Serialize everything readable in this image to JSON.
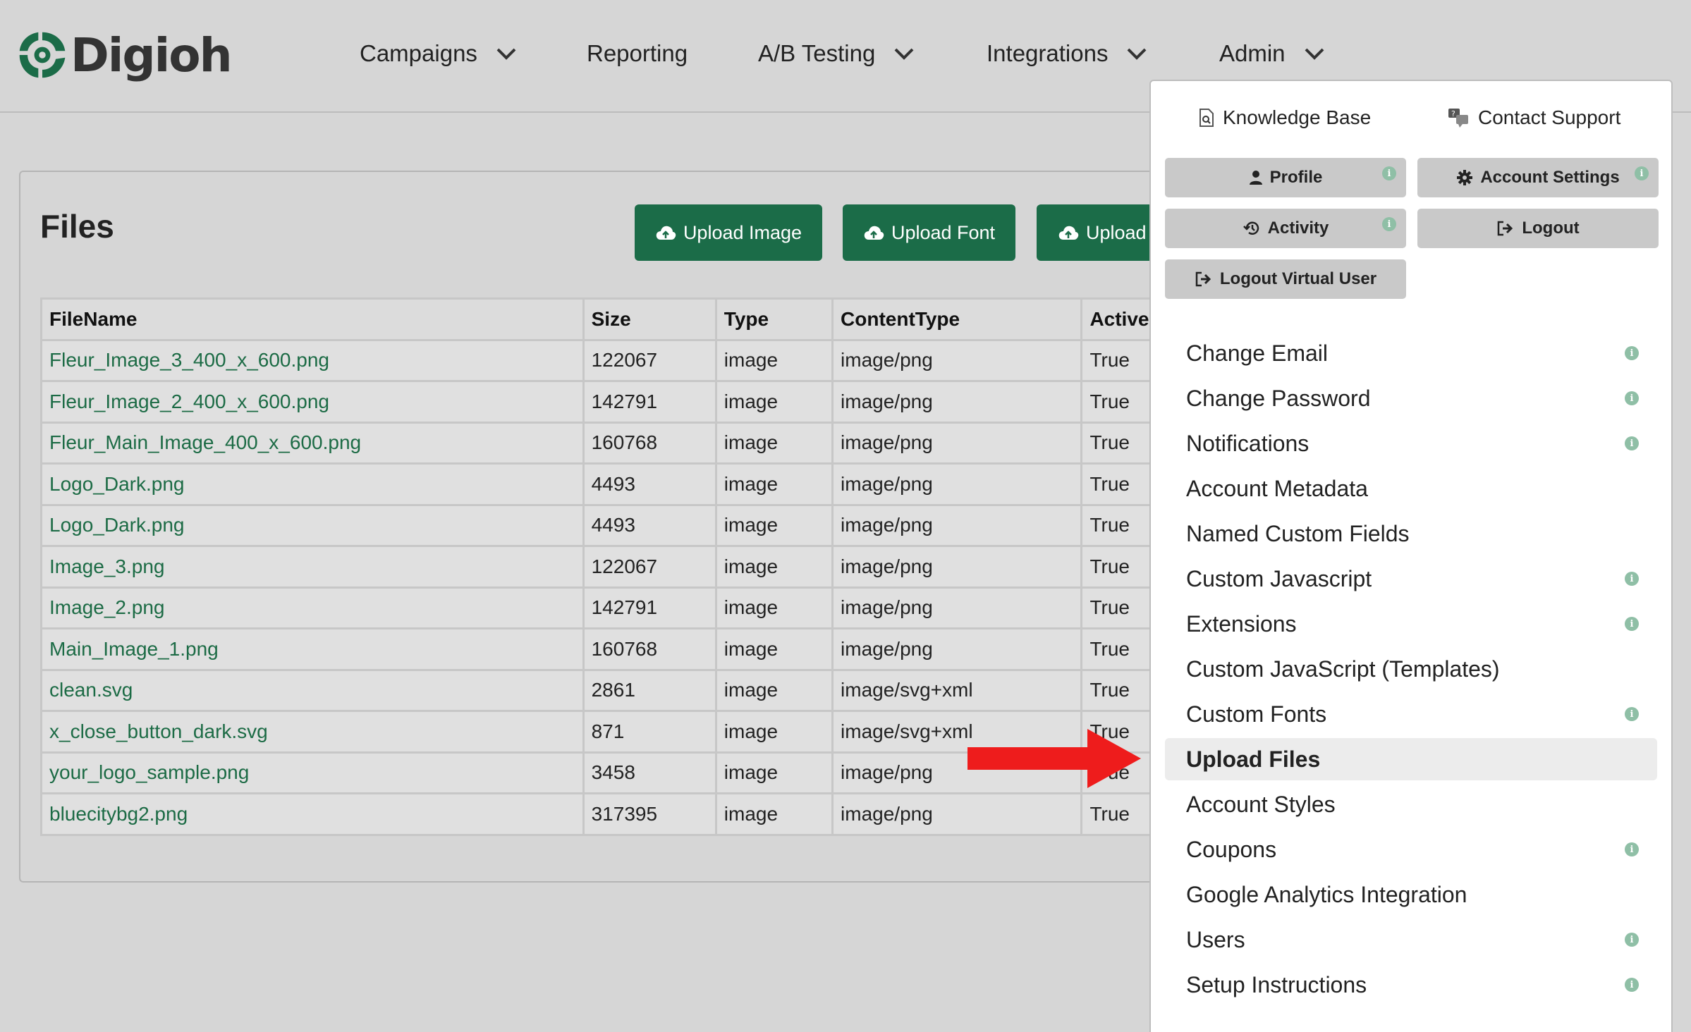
{
  "brand": {
    "name": "Digioh",
    "accent": "#1b6c48"
  },
  "nav": {
    "items": [
      {
        "label": "Campaigns",
        "dropdown": true
      },
      {
        "label": "Reporting",
        "dropdown": false
      },
      {
        "label": "A/B Testing",
        "dropdown": true
      },
      {
        "label": "Integrations",
        "dropdown": true
      },
      {
        "label": "Admin",
        "dropdown": true
      }
    ]
  },
  "files_panel": {
    "title": "Files",
    "buttons": [
      {
        "label": "Upload Image",
        "icon": "cloud-upload-icon"
      },
      {
        "label": "Upload Font",
        "icon": "cloud-upload-icon"
      },
      {
        "label": "Upload",
        "icon": "cloud-upload-icon"
      }
    ],
    "table": {
      "columns": [
        "FileName",
        "Size",
        "Type",
        "ContentType",
        "Active"
      ],
      "rows": [
        {
          "name": "Fleur_Image_3_400_x_600.png",
          "size": "122067",
          "type": "image",
          "content_type": "image/png",
          "active": "True"
        },
        {
          "name": "Fleur_Image_2_400_x_600.png",
          "size": "142791",
          "type": "image",
          "content_type": "image/png",
          "active": "True"
        },
        {
          "name": "Fleur_Main_Image_400_x_600.png",
          "size": "160768",
          "type": "image",
          "content_type": "image/png",
          "active": "True"
        },
        {
          "name": "Logo_Dark.png",
          "size": "4493",
          "type": "image",
          "content_type": "image/png",
          "active": "True"
        },
        {
          "name": "Logo_Dark.png",
          "size": "4493",
          "type": "image",
          "content_type": "image/png",
          "active": "True"
        },
        {
          "name": "Image_3.png",
          "size": "122067",
          "type": "image",
          "content_type": "image/png",
          "active": "True"
        },
        {
          "name": "Image_2.png",
          "size": "142791",
          "type": "image",
          "content_type": "image/png",
          "active": "True"
        },
        {
          "name": "Main_Image_1.png",
          "size": "160768",
          "type": "image",
          "content_type": "image/png",
          "active": "True"
        },
        {
          "name": "clean.svg",
          "size": "2861",
          "type": "image",
          "content_type": "image/svg+xml",
          "active": "True"
        },
        {
          "name": "x_close_button_dark.svg",
          "size": "871",
          "type": "image",
          "content_type": "image/svg+xml",
          "active": "True"
        },
        {
          "name": "your_logo_sample.png",
          "size": "3458",
          "type": "image",
          "content_type": "image/png",
          "active": "True"
        },
        {
          "name": "bluecitybg2.png",
          "size": "317395",
          "type": "image",
          "content_type": "image/png",
          "active": "True"
        }
      ]
    }
  },
  "admin_dropdown": {
    "knowledge_base": "Knowledge Base",
    "contact_support": "Contact Support",
    "buttons": {
      "profile": "Profile",
      "account_settings": "Account Settings",
      "activity": "Activity",
      "logout": "Logout",
      "logout_virtual_user": "Logout Virtual User"
    },
    "info_glyph": "i",
    "menu": [
      {
        "label": "Change Email",
        "info": true,
        "active": false
      },
      {
        "label": "Change Password",
        "info": true,
        "active": false
      },
      {
        "label": "Notifications",
        "info": true,
        "active": false
      },
      {
        "label": "Account Metadata",
        "info": false,
        "active": false
      },
      {
        "label": "Named Custom Fields",
        "info": false,
        "active": false
      },
      {
        "label": "Custom Javascript",
        "info": true,
        "active": false
      },
      {
        "label": "Extensions",
        "info": true,
        "active": false
      },
      {
        "label": "Custom JavaScript (Templates)",
        "info": false,
        "active": false
      },
      {
        "label": "Custom Fonts",
        "info": true,
        "active": false
      },
      {
        "label": "Upload Files",
        "info": false,
        "active": true
      },
      {
        "label": "Account Styles",
        "info": false,
        "active": false
      },
      {
        "label": "Coupons",
        "info": true,
        "active": false
      },
      {
        "label": "Google Analytics Integration",
        "info": false,
        "active": false
      },
      {
        "label": "Users",
        "info": true,
        "active": false
      },
      {
        "label": "Setup Instructions",
        "info": true,
        "active": false
      }
    ]
  },
  "annotation": {
    "arrow_color": "#ee1c1c"
  }
}
